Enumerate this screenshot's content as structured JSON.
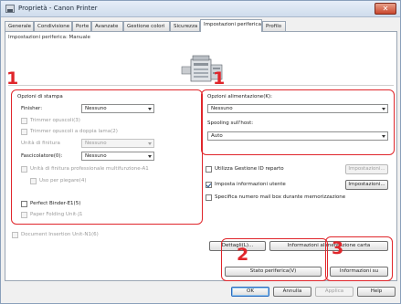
{
  "window": {
    "title": "Proprietà - Canon Printer",
    "close_label": "✕"
  },
  "tabs": [
    {
      "label": "Generale"
    },
    {
      "label": "Condivisione"
    },
    {
      "label": "Porte"
    },
    {
      "label": "Avanzate"
    },
    {
      "label": "Gestione colori"
    },
    {
      "label": "Sicurezza"
    },
    {
      "label": "Impostazioni periferica"
    },
    {
      "label": "Profilo"
    }
  ],
  "panel": {
    "subheading": "Impostazioni periferica: Manuale"
  },
  "print_options": {
    "group_label": "Opzioni di stampa",
    "finisher_label": "Finisher:",
    "finisher_value": "Nessuno",
    "trimmer_label": "Trimmer opuscoli(3)",
    "trimmer_double_label": "Trimmer opuscoli a doppia lama(2)",
    "binding_unit_label": "Unità di finitura",
    "binding_unit_value": "Nessuno",
    "folding_label": "Fascicolatore(0):",
    "folding_value": "Nessuno",
    "pro_binding_label": "Unità di finitura professionale multifunzione-A1",
    "use_folder_label": "Uso per piegare(4)",
    "perfect_binder_label": "Perfect Binder-E1(5)",
    "paper_folding_label": "Paper Folding Unit-J1"
  },
  "feed_options": {
    "feed_label": "Opzioni alimentazione(K):",
    "feed_value": "Nessuno",
    "spooling_label": "Spooling sull'host:",
    "spooling_value": "Auto"
  },
  "device_options": {
    "use_dept_id_label": "Utilizza Gestione ID reparto",
    "use_dept_id_settings": "Impostazioni...",
    "set_user_info_label": "Imposta informazioni utente",
    "set_user_info_settings": "Impostazioni...",
    "mailbox_label": "Specifica numero mail box durante memorizzazione"
  },
  "document_insertion_label": "Document Insertion Unit-N1(6)",
  "buttons": {
    "details": "Dettagli(L)...",
    "paper_info": "Informazioni alimentazione carta",
    "device_status": "Stato periferica(V)",
    "about": "Informazioni su",
    "ok": "OK",
    "cancel": "Annulla",
    "apply": "Applica",
    "help": "Help"
  },
  "callouts": {
    "one_left": "1",
    "one_right": "1",
    "two": "2",
    "three": "3"
  },
  "accent": {
    "callout_color": "#e0262b"
  }
}
